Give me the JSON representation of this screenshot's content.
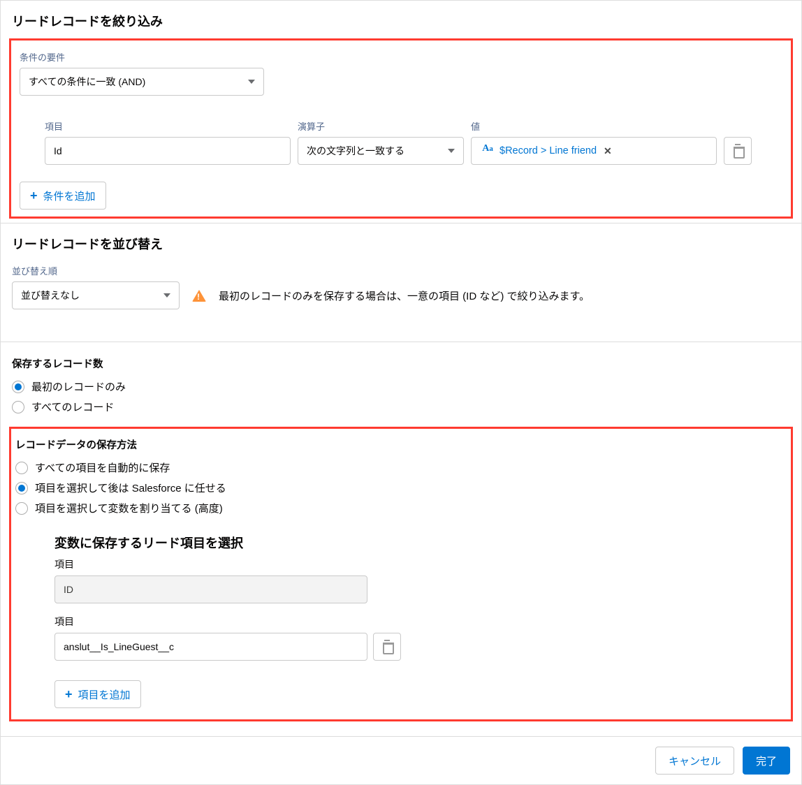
{
  "filter": {
    "header": "リードレコードを絞り込み",
    "requirement_label": "条件の要件",
    "requirement_value": "すべての条件に一致 (AND)",
    "columns": {
      "field": "項目",
      "operator": "演算子",
      "value": "値"
    },
    "condition": {
      "field": "Id",
      "operator": "次の文字列と一致する",
      "value": "$Record > Line friend"
    },
    "add_condition": "条件を追加"
  },
  "sort": {
    "header": "リードレコードを並び替え",
    "order_label": "並び替え順",
    "order_value": "並び替えなし",
    "warning": "最初のレコードのみを保存する場合は、一意の項目 (ID など) で絞り込みます。"
  },
  "store_count": {
    "label": "保存するレコード数",
    "options": {
      "first": "最初のレコードのみ",
      "all": "すべてのレコード"
    }
  },
  "store_method": {
    "label": "レコードデータの保存方法",
    "options": {
      "auto": "すべての項目を自動的に保存",
      "select_sf": "項目を選択して後は Salesforce に任せる",
      "select_var": "項目を選択して変数を割り当てる (高度)"
    }
  },
  "select_fields": {
    "header": "変数に保存するリード項目を選択",
    "field_label": "項目",
    "id_value": "ID",
    "api_value": "anslut__Is_LineGuest__c",
    "add_field": "項目を追加"
  },
  "footer": {
    "cancel": "キャンセル",
    "done": "完了"
  }
}
